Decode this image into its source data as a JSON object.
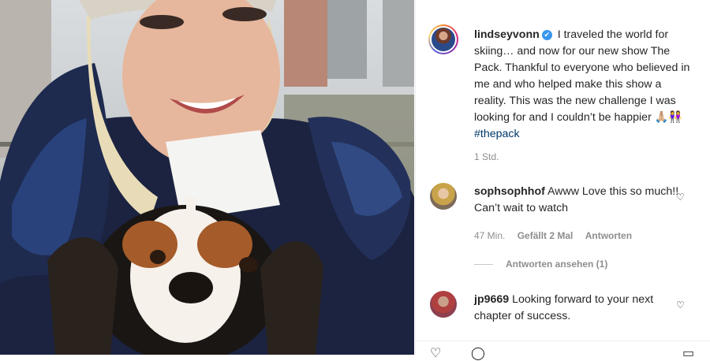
{
  "post": {
    "username": "lindseyvonn",
    "caption": "I traveled the world for skiing… and now for our new show The Pack. Thankful to everyone who believed in me and who helped make this show a reality. This was the new challenge I was looking for and I couldn’t be happier 🙏🏼👭",
    "hashtag": "#thepack",
    "time": "1 Std."
  },
  "comments": [
    {
      "username": "sophsophhof",
      "text": "Awww Love this so much!! Can’t wait to watch",
      "time": "47 Min.",
      "likes": "Gefällt 2 Mal",
      "reply": "Antworten",
      "view_replies": "Antworten ansehen (1)"
    },
    {
      "username": "jp9669",
      "text": "Looking forward to your next chapter of success."
    }
  ],
  "icons": {
    "verified": "verified-badge-icon",
    "heart": "heart-icon"
  },
  "colors": {
    "verified": "#3897f0",
    "hashtag": "#00376b",
    "muted": "#8e8e8e"
  }
}
